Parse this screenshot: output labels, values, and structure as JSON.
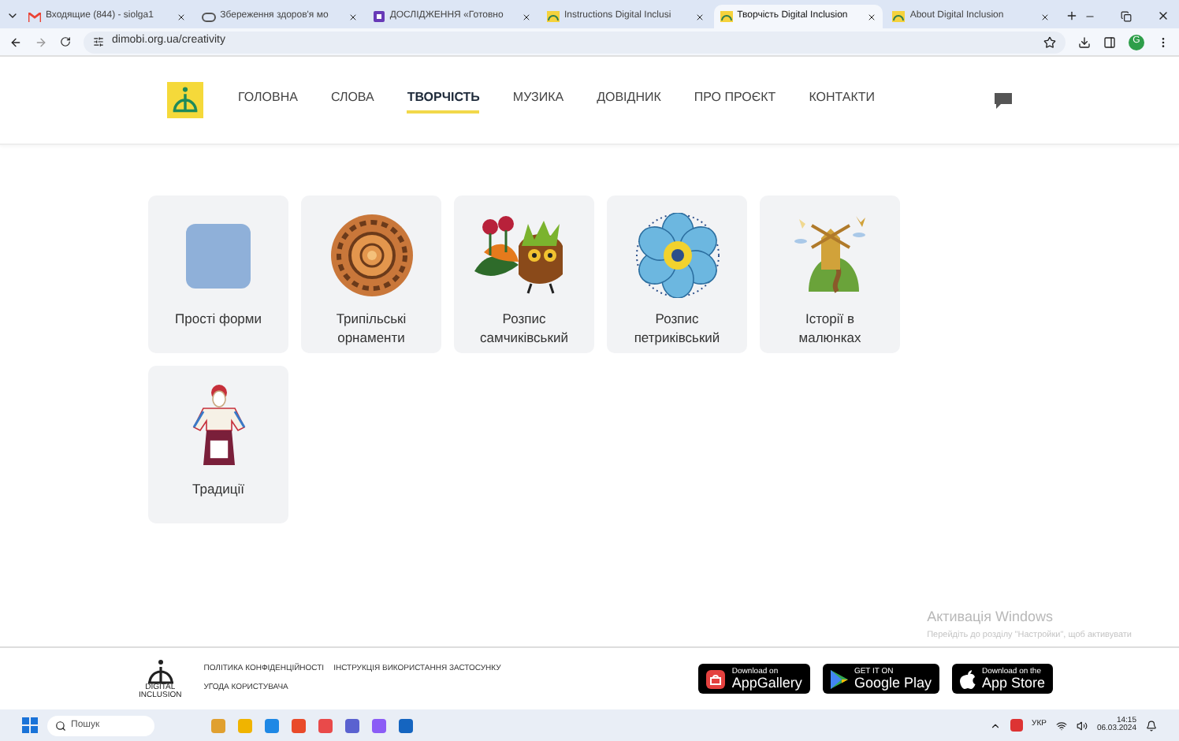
{
  "browser": {
    "tabs": [
      {
        "title": "Входящие (844) - siolga1",
        "kind": "mail",
        "selected": false
      },
      {
        "title": "Збереження здоров'я мо",
        "kind": "link",
        "selected": false
      },
      {
        "title": "ДОСЛІДЖЕННЯ «Готовно",
        "kind": "form",
        "selected": false
      },
      {
        "title": "Instructions Digital Inclusi",
        "kind": "site",
        "selected": false
      },
      {
        "title": "Творчість Digital Inclusion",
        "kind": "site",
        "selected": true
      },
      {
        "title": "About Digital Inclusion",
        "kind": "site",
        "selected": false
      }
    ],
    "url": "dimobi.org.ua/creativity",
    "profile": "G"
  },
  "nav": {
    "items": [
      {
        "label": "ГОЛОВНА",
        "selected": false
      },
      {
        "label": "СЛОВА",
        "selected": false
      },
      {
        "label": "ТВОРЧІСТЬ",
        "selected": true
      },
      {
        "label": "МУЗИКА",
        "selected": false
      },
      {
        "label": "ДОВІДНИК",
        "selected": false
      },
      {
        "label": "ПРО ПРОЄКТ",
        "selected": false
      },
      {
        "label": "КОНТАКТИ",
        "selected": false
      }
    ]
  },
  "cards": [
    {
      "label": "Прості форми",
      "kind": "square"
    },
    {
      "label": "Трипільські орнаменти",
      "kind": "ornament"
    },
    {
      "label": "Розпис самчиківський",
      "kind": "bird"
    },
    {
      "label": "Розпис петриківський",
      "kind": "flower"
    },
    {
      "label": "Історії в малюнках",
      "kind": "windmill"
    },
    {
      "label": "Традиції",
      "kind": "doll"
    }
  ],
  "footer": {
    "logo_lines": [
      "DIGITAL",
      "INCLUSION"
    ],
    "links": [
      "ПОЛІТИКА КОНФІДЕНЦІЙНОСТІ",
      "ІНСТРУКЦІЯ ВИКОРИСТАННЯ ЗАСТОСУНКУ",
      "УГОДА КОРИСТУВАЧА"
    ],
    "stores": [
      {
        "small": "Download on",
        "big": "AppGallery",
        "kind": "huawei"
      },
      {
        "small": "GET IT ON",
        "big": "Google Play",
        "kind": "google"
      },
      {
        "small": "Download on the",
        "big": "App Store",
        "kind": "apple"
      }
    ]
  },
  "activation": {
    "title": "Активація Windows",
    "text": "Перейдіть до розділу \"Настройки\", щоб активувати"
  },
  "taskbar": {
    "search": "Пошук",
    "lang": "УКР",
    "time": "14:15",
    "date": "06.03.2024"
  }
}
